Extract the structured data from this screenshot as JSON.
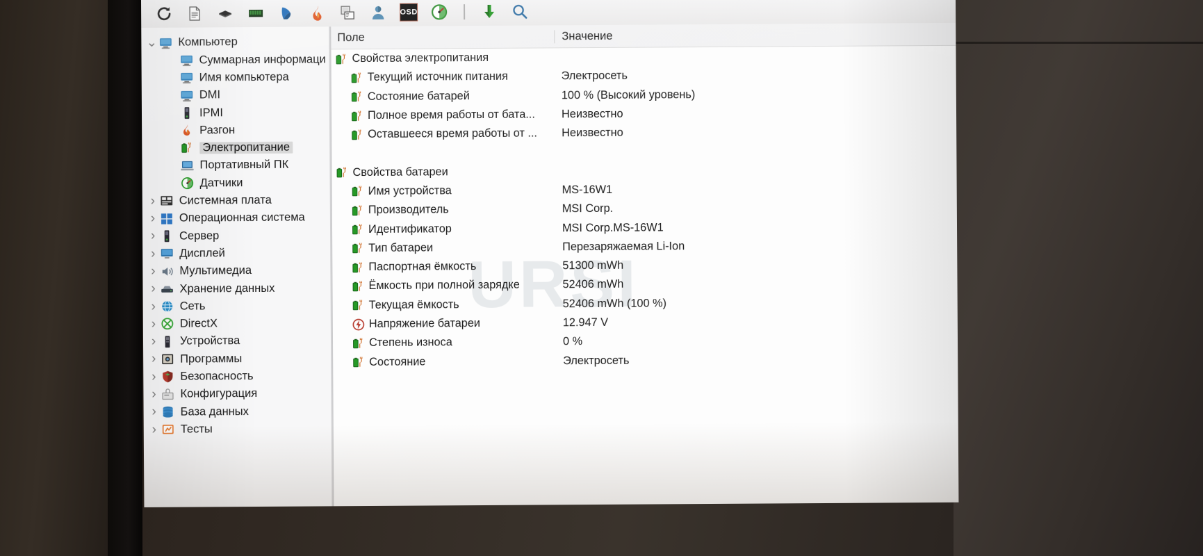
{
  "app": {
    "name": "AIDA64",
    "accent_green": "#1f9c1f",
    "selection_color": "#d8d8d8"
  },
  "toolbar": {
    "items": [
      {
        "name": "refresh-icon",
        "tooltip": "Обновить"
      },
      {
        "name": "report-icon",
        "tooltip": "Отчёт"
      },
      {
        "name": "cpu-icon",
        "tooltip": "CPUID"
      },
      {
        "name": "memory-icon",
        "tooltip": "Тест памяти"
      },
      {
        "name": "mouse-icon",
        "tooltip": "Монитор"
      },
      {
        "name": "flame-icon",
        "tooltip": "Системная стабильность"
      },
      {
        "name": "screenshot-icon",
        "tooltip": "Снимок экрана"
      },
      {
        "name": "user-icon",
        "tooltip": "Пользователь"
      },
      {
        "name": "osd-icon",
        "tooltip": "OSD",
        "label": "OSD"
      },
      {
        "name": "sensor-icon",
        "tooltip": "Датчики"
      },
      {
        "name": "separator",
        "tooltip": ""
      },
      {
        "name": "download-icon",
        "tooltip": "Загрузка"
      },
      {
        "name": "search-icon",
        "tooltip": "Поиск"
      }
    ]
  },
  "sidebar": {
    "items": [
      {
        "label": "Компьютер",
        "level": 1,
        "twist": "v",
        "icon": "computer-icon",
        "selected": false
      },
      {
        "label": "Суммарная информаци",
        "level": 2,
        "twist": "",
        "icon": "computer-icon",
        "selected": false
      },
      {
        "label": "Имя компьютера",
        "level": 2,
        "twist": "",
        "icon": "computer-icon",
        "selected": false
      },
      {
        "label": "DMI",
        "level": 2,
        "twist": "",
        "icon": "computer-icon",
        "selected": false
      },
      {
        "label": "IPMI",
        "level": 2,
        "twist": "",
        "icon": "server-icon",
        "selected": false
      },
      {
        "label": "Разгон",
        "level": 2,
        "twist": "",
        "icon": "flame-icon",
        "selected": false
      },
      {
        "label": "Электропитание",
        "level": 2,
        "twist": "",
        "icon": "battery-icon",
        "selected": true
      },
      {
        "label": "Портативный ПК",
        "level": 2,
        "twist": "",
        "icon": "laptop-icon",
        "selected": false
      },
      {
        "label": "Датчики",
        "level": 2,
        "twist": "",
        "icon": "sensor-icon",
        "selected": false
      },
      {
        "label": "Системная плата",
        "level": 1,
        "twist": ">",
        "icon": "mainboard-icon",
        "selected": false
      },
      {
        "label": "Операционная система",
        "level": 1,
        "twist": ">",
        "icon": "windows-icon",
        "selected": false
      },
      {
        "label": "Сервер",
        "level": 1,
        "twist": ">",
        "icon": "server-icon",
        "selected": false
      },
      {
        "label": "Дисплей",
        "level": 1,
        "twist": ">",
        "icon": "display-icon",
        "selected": false
      },
      {
        "label": "Мультимедиа",
        "level": 1,
        "twist": ">",
        "icon": "speaker-icon",
        "selected": false
      },
      {
        "label": "Хранение данных",
        "level": 1,
        "twist": ">",
        "icon": "hdd-icon",
        "selected": false
      },
      {
        "label": "Сеть",
        "level": 1,
        "twist": ">",
        "icon": "network-icon",
        "selected": false
      },
      {
        "label": "DirectX",
        "level": 1,
        "twist": ">",
        "icon": "directx-icon",
        "selected": false
      },
      {
        "label": "Устройства",
        "level": 1,
        "twist": ">",
        "icon": "device-icon",
        "selected": false
      },
      {
        "label": "Программы",
        "level": 1,
        "twist": ">",
        "icon": "programs-icon",
        "selected": false
      },
      {
        "label": "Безопасность",
        "level": 1,
        "twist": ">",
        "icon": "shield-icon",
        "selected": false
      },
      {
        "label": "Конфигурация",
        "level": 1,
        "twist": ">",
        "icon": "config-icon",
        "selected": false
      },
      {
        "label": "База данных",
        "level": 1,
        "twist": ">",
        "icon": "database-icon",
        "selected": false
      },
      {
        "label": "Тесты",
        "level": 1,
        "twist": ">",
        "icon": "benchmark-icon",
        "selected": false
      }
    ]
  },
  "detail": {
    "columns": {
      "field": "Поле",
      "value": "Значение"
    },
    "watermark": "URSI",
    "rows": [
      {
        "field": "Свойства электропитания",
        "value": "",
        "indent": false,
        "icon": "battery-icon"
      },
      {
        "field": "Текущий источник питания",
        "value": "Электросеть",
        "indent": true,
        "icon": "battery-icon"
      },
      {
        "field": "Состояние батарей",
        "value": "100 % (Высокий уровень)",
        "indent": true,
        "icon": "battery-icon"
      },
      {
        "field": "Полное время работы от бата...",
        "value": "Неизвестно",
        "indent": true,
        "icon": "battery-icon"
      },
      {
        "field": "Оставшееся время работы от ...",
        "value": "Неизвестно",
        "indent": true,
        "icon": "battery-icon"
      },
      {
        "field": "",
        "value": "",
        "indent": false,
        "icon": "none"
      },
      {
        "field": "Свойства батареи",
        "value": "",
        "indent": false,
        "icon": "battery-icon"
      },
      {
        "field": "Имя устройства",
        "value": "MS-16W1",
        "indent": true,
        "icon": "battery-icon"
      },
      {
        "field": "Производитель",
        "value": "MSI Corp.",
        "indent": true,
        "icon": "battery-icon"
      },
      {
        "field": "Идентификатор",
        "value": "MSI Corp.MS-16W1",
        "indent": true,
        "icon": "battery-icon"
      },
      {
        "field": "Тип батареи",
        "value": "Перезаряжаемая Li-Ion",
        "indent": true,
        "icon": "battery-icon"
      },
      {
        "field": "Паспортная ёмкость",
        "value": "51300 mWh",
        "indent": true,
        "icon": "battery-icon"
      },
      {
        "field": "Ёмкость при полной зарядке",
        "value": "52406 mWh",
        "indent": true,
        "icon": "battery-icon"
      },
      {
        "field": "Текущая ёмкость",
        "value": "52406 mWh  (100 %)",
        "indent": true,
        "icon": "battery-icon"
      },
      {
        "field": "Напряжение батареи",
        "value": "12.947 V",
        "indent": true,
        "icon": "voltage-icon"
      },
      {
        "field": "Степень износа",
        "value": "0 %",
        "indent": true,
        "icon": "battery-icon"
      },
      {
        "field": "Состояние",
        "value": "Электросеть",
        "indent": true,
        "icon": "battery-icon"
      }
    ]
  }
}
